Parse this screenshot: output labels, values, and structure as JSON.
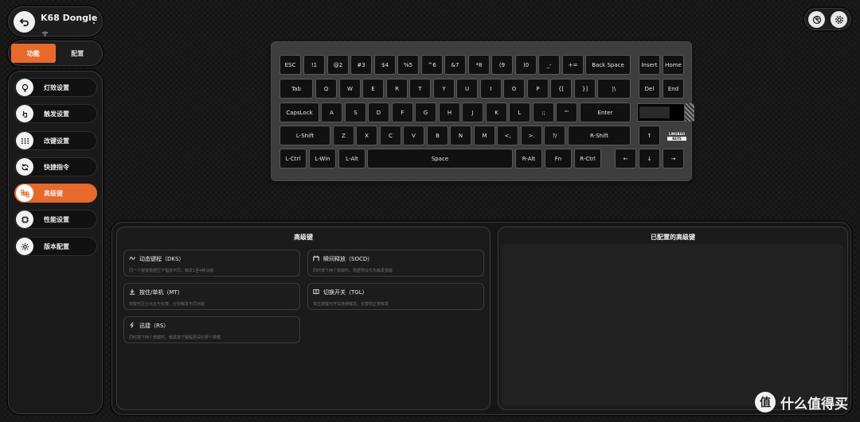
{
  "device": {
    "name": "K68 Dongle"
  },
  "tabs": [
    "功能",
    "配置"
  ],
  "menu": [
    {
      "label": "灯效设置",
      "icon": "bulb-icon"
    },
    {
      "label": "触发设置",
      "icon": "touch-icon"
    },
    {
      "label": "改键设置",
      "icon": "keypad-icon"
    },
    {
      "label": "快捷指令",
      "icon": "shortcut-icon"
    },
    {
      "label": "高级键",
      "icon": "command-icon",
      "active": true
    },
    {
      "label": "性能设置",
      "icon": "chip-icon"
    },
    {
      "label": "版本配置",
      "icon": "gear-icon"
    }
  ],
  "keyboard": {
    "keys": [
      "ESC",
      "!1",
      "@2",
      "#3",
      "$4",
      "%5",
      "^6",
      "&7",
      "*8",
      "(9",
      ")0",
      "_-",
      "+=",
      "Back Space",
      "Insert",
      "Home",
      "Tab",
      "Q",
      "W",
      "E",
      "R",
      "T",
      "Y",
      "U",
      "I",
      "O",
      "P",
      "{[",
      "}]",
      "|\\",
      "Del",
      "End",
      "CapsLock",
      "A",
      "S",
      "D",
      "F",
      "G",
      "H",
      "J",
      "K",
      "L",
      ":;",
      "\"'",
      "Enter",
      "L-Shift",
      "Z",
      "X",
      "C",
      "V",
      "B",
      "N",
      "M",
      "<,",
      ">.",
      "?/",
      "R-Shift",
      "↑",
      "L-Ctrl",
      "L-Win",
      "L-Alt",
      "Space",
      "R-Alt",
      "Fn",
      "R-Ctrl",
      "←",
      "↓",
      "→"
    ],
    "logo": {
      "line1": "LINGBAO",
      "line2": "KEYS"
    }
  },
  "advanced": {
    "title": "高级键",
    "cards": [
      {
        "title": "动态键程（DKS）",
        "desc": "同一个按键根据压下程度不同，触发1至4种功能",
        "icon": "dks-icon"
      },
      {
        "title": "瞬间释放（SOCD）",
        "desc": "同时按下两个按键时，根据预设优先触发按键",
        "icon": "socd-icon"
      },
      {
        "title": "按住/单机（MT）",
        "desc": "单键可区分点击与长按，分别触发不同功能",
        "icon": "mt-icon"
      },
      {
        "title": "切换开关（TGL）",
        "desc": "单击按键可开关持续触发，长按则正常触发",
        "icon": "tgl-icon"
      },
      {
        "title": "迅捷（RS）",
        "desc": "同时按下两个按键时，触发按下键程更深的那个按键",
        "icon": "rs-icon"
      }
    ]
  },
  "configured": {
    "title": "已配置的高级键"
  },
  "watermark": {
    "glyph": "值",
    "text": "什么值得买"
  },
  "colors": {
    "accent": "#e7692c",
    "background": "#141414"
  }
}
